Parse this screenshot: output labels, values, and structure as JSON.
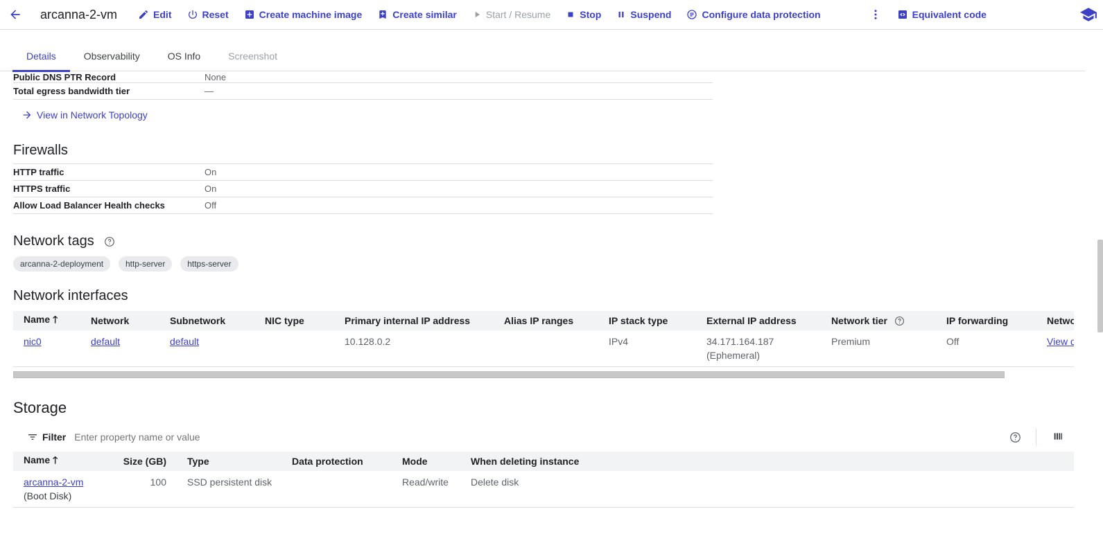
{
  "header": {
    "vm_name": "arcanna-2-vm",
    "actions": {
      "edit": "Edit",
      "reset": "Reset",
      "create_machine_image": "Create machine image",
      "create_similar": "Create similar",
      "start_resume": "Start / Resume",
      "stop": "Stop",
      "suspend": "Suspend",
      "configure_data_protection": "Configure data protection",
      "equivalent_code": "Equivalent code"
    }
  },
  "tabs": [
    "Details",
    "Observability",
    "OS Info",
    "Screenshot"
  ],
  "network_details": {
    "rows": [
      {
        "label": "Public DNS PTR Record",
        "value": "None"
      },
      {
        "label": "Total egress bandwidth tier",
        "value": "—"
      }
    ],
    "topology_link": "View in Network Topology"
  },
  "firewalls": {
    "title": "Firewalls",
    "rows": [
      {
        "label": "HTTP traffic",
        "value": "On"
      },
      {
        "label": "HTTPS traffic",
        "value": "On"
      },
      {
        "label": "Allow Load Balancer Health checks",
        "value": "Off"
      }
    ]
  },
  "network_tags": {
    "title": "Network tags",
    "tags": [
      "arcanna-2-deployment",
      "http-server",
      "https-server"
    ]
  },
  "network_interfaces": {
    "title": "Network interfaces",
    "columns": [
      "Name",
      "Network",
      "Subnetwork",
      "NIC type",
      "Primary internal IP address",
      "Alias IP ranges",
      "IP stack type",
      "External IP address",
      "Network tier",
      "IP forwarding",
      "Netwo"
    ],
    "row": {
      "name": "nic0",
      "network": "default",
      "subnetwork": "default",
      "nic_type": "",
      "primary_ip": "10.128.0.2",
      "alias_ip": "",
      "ip_stack": "IPv4",
      "external_ip": "34.171.164.187",
      "external_ip_note": "(Ephemeral)",
      "network_tier": "Premium",
      "ip_forwarding": "Off",
      "network_link": "View d"
    }
  },
  "storage": {
    "title": "Storage",
    "filter_label": "Filter",
    "filter_placeholder": "Enter property name or value",
    "columns": [
      "Name",
      "Size (GB)",
      "Type",
      "Data protection",
      "Mode",
      "When deleting instance"
    ],
    "row": {
      "name": "arcanna-2-vm",
      "name_note": "(Boot Disk)",
      "size": "100",
      "type": "SSD persistent disk",
      "data_protection": "",
      "mode": "Read/write",
      "when_deleting": "Delete disk"
    }
  },
  "colors": {
    "accent": "#3c40c6",
    "muted": "#5f6368",
    "border": "#dadce0"
  }
}
